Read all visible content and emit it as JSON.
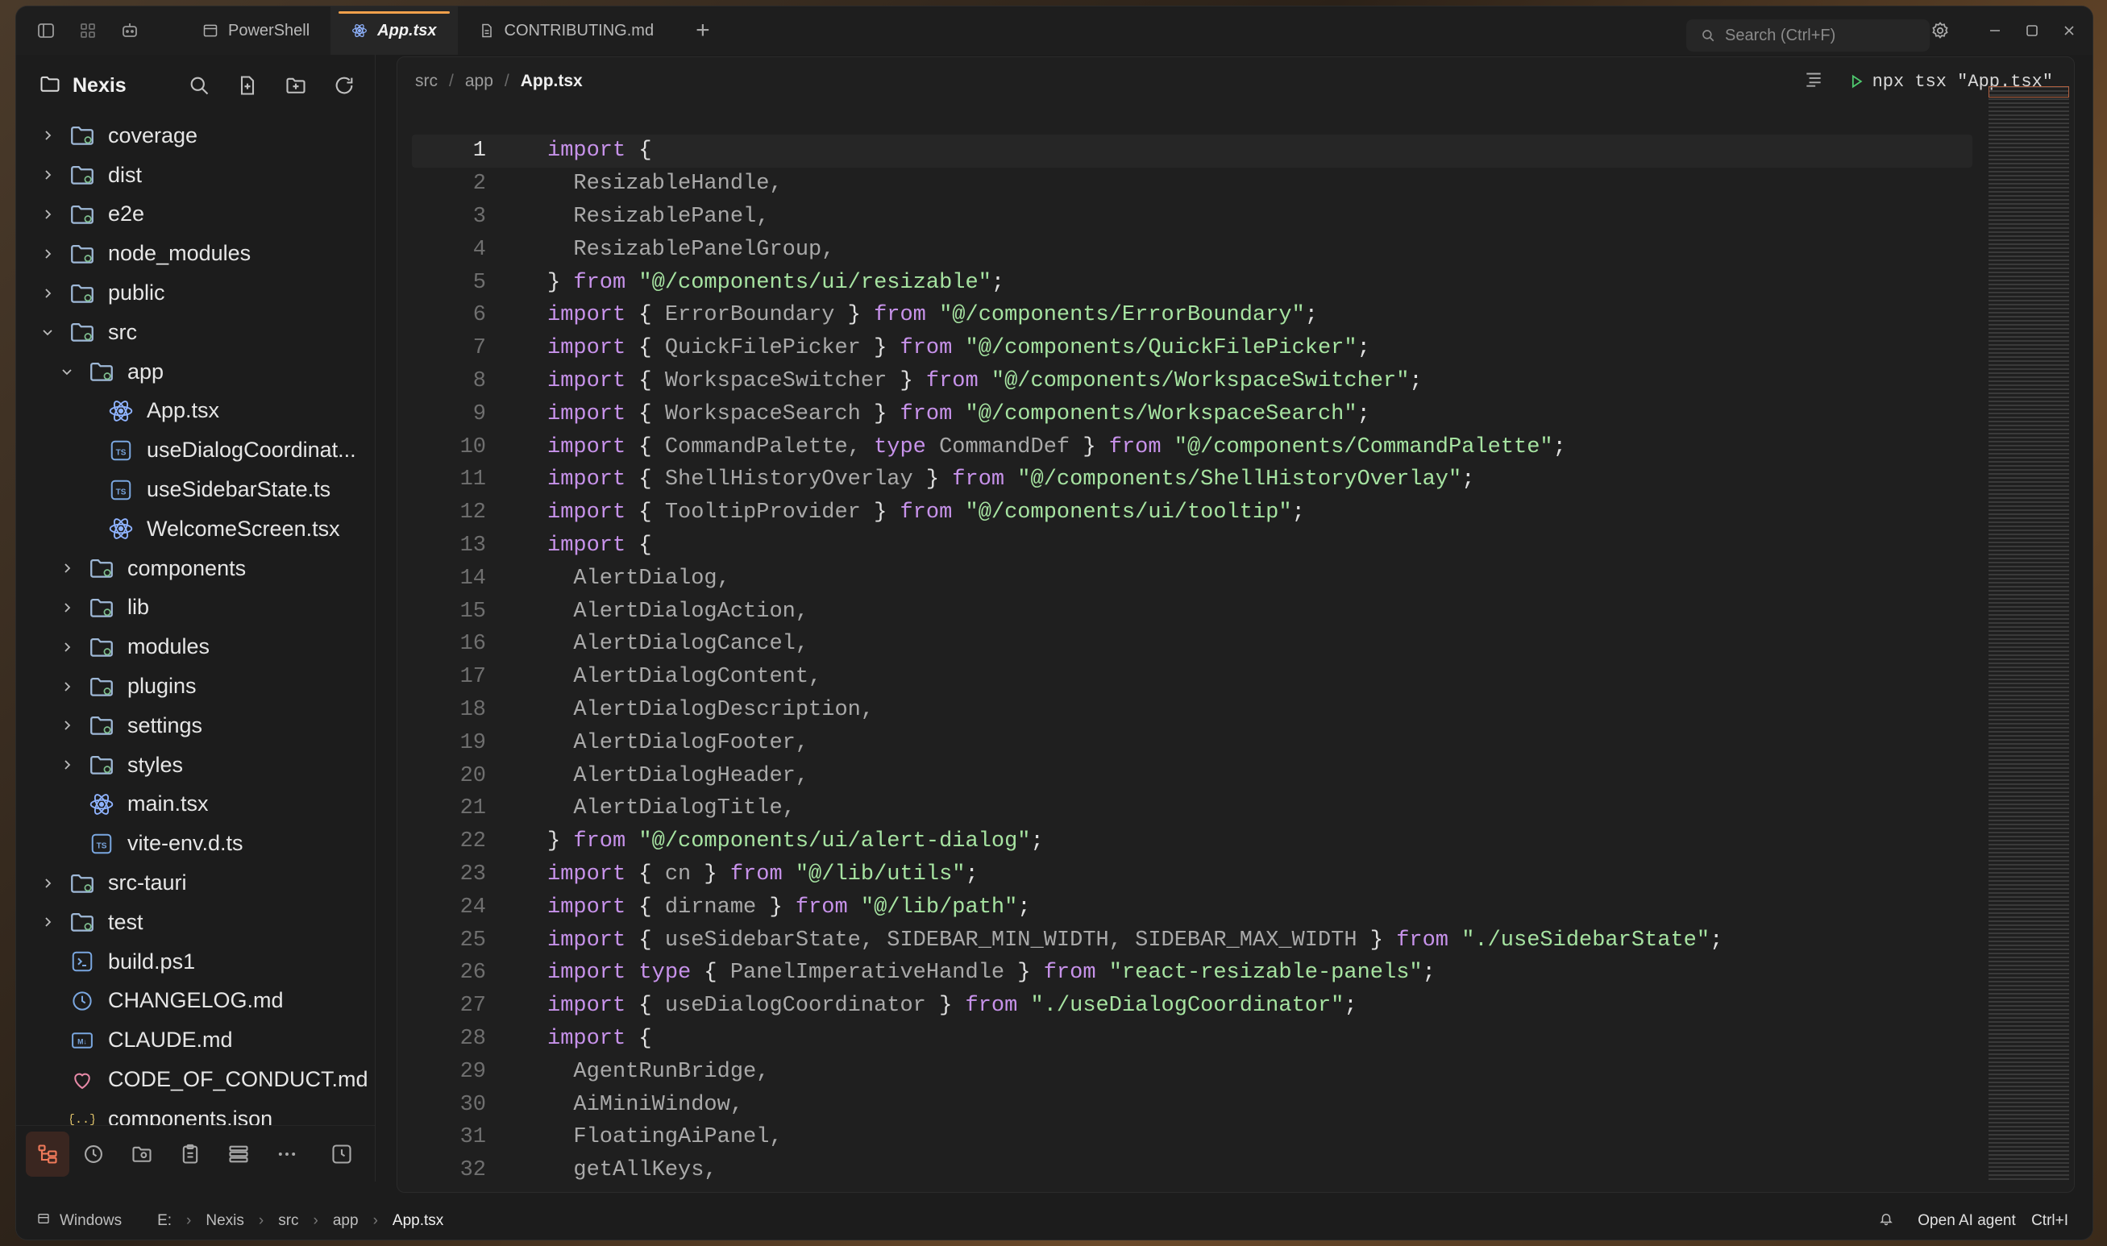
{
  "titlebar": {
    "tabs": [
      {
        "label": "PowerShell",
        "icon": "terminal-icon",
        "active": false
      },
      {
        "label": "App.tsx",
        "icon": "react-icon",
        "active": true
      },
      {
        "label": "CONTRIBUTING.md",
        "icon": "document-icon",
        "active": false
      }
    ],
    "new_tab": "+",
    "search_placeholder": "Search (Ctrl+F)"
  },
  "sidebar": {
    "title": "Nexis",
    "tree": [
      {
        "label": "coverage",
        "type": "folder",
        "expanded": false,
        "depth": 0
      },
      {
        "label": "dist",
        "type": "folder",
        "expanded": false,
        "depth": 0
      },
      {
        "label": "e2e",
        "type": "folder",
        "expanded": false,
        "depth": 0
      },
      {
        "label": "node_modules",
        "type": "folder",
        "expanded": false,
        "depth": 0
      },
      {
        "label": "public",
        "type": "folder",
        "expanded": false,
        "depth": 0
      },
      {
        "label": "src",
        "type": "folder",
        "expanded": true,
        "depth": 0
      },
      {
        "label": "app",
        "type": "folder",
        "expanded": true,
        "depth": 1
      },
      {
        "label": "App.tsx",
        "type": "react",
        "depth": 2
      },
      {
        "label": "useDialogCoordinat...",
        "type": "ts",
        "depth": 2
      },
      {
        "label": "useSidebarState.ts",
        "type": "ts",
        "depth": 2
      },
      {
        "label": "WelcomeScreen.tsx",
        "type": "react",
        "depth": 2
      },
      {
        "label": "components",
        "type": "folder",
        "expanded": false,
        "depth": 1
      },
      {
        "label": "lib",
        "type": "folder",
        "expanded": false,
        "depth": 1
      },
      {
        "label": "modules",
        "type": "folder",
        "expanded": false,
        "depth": 1
      },
      {
        "label": "plugins",
        "type": "folder",
        "expanded": false,
        "depth": 1
      },
      {
        "label": "settings",
        "type": "folder",
        "expanded": false,
        "depth": 1
      },
      {
        "label": "styles",
        "type": "folder",
        "expanded": false,
        "depth": 1
      },
      {
        "label": "main.tsx",
        "type": "react",
        "depth": 1
      },
      {
        "label": "vite-env.d.ts",
        "type": "ts",
        "depth": 1
      },
      {
        "label": "src-tauri",
        "type": "folder",
        "expanded": false,
        "depth": 0
      },
      {
        "label": "test",
        "type": "folder",
        "expanded": false,
        "depth": 0
      },
      {
        "label": "build.ps1",
        "type": "ps",
        "depth": 0
      },
      {
        "label": "CHANGELOG.md",
        "type": "history",
        "depth": 0
      },
      {
        "label": "CLAUDE.md",
        "type": "md",
        "depth": 0
      },
      {
        "label": "CODE_OF_CONDUCT.md",
        "type": "heart",
        "depth": 0
      },
      {
        "label": "components.json",
        "type": "json",
        "depth": 0
      }
    ]
  },
  "editor": {
    "breadcrumb": [
      "src",
      "app",
      "App.tsx"
    ],
    "run_label": "npx tsx \"App.tsx\"",
    "lines": [
      [
        [
          "kw",
          "import"
        ],
        [
          "punc",
          " {"
        ]
      ],
      [
        [
          "ident",
          "  ResizableHandle,"
        ]
      ],
      [
        [
          "ident",
          "  ResizablePanel,"
        ]
      ],
      [
        [
          "ident",
          "  ResizablePanelGroup,"
        ]
      ],
      [
        [
          "punc",
          "} "
        ],
        [
          "kw",
          "from"
        ],
        [
          "str",
          " \"@/components/ui/resizable\""
        ],
        [
          "punc",
          ";"
        ]
      ],
      [
        [
          "kw",
          "import"
        ],
        [
          "punc",
          " { "
        ],
        [
          "ident",
          "ErrorBoundary"
        ],
        [
          "punc",
          " } "
        ],
        [
          "kw",
          "from"
        ],
        [
          "str",
          " \"@/components/ErrorBoundary\""
        ],
        [
          "punc",
          ";"
        ]
      ],
      [
        [
          "kw",
          "import"
        ],
        [
          "punc",
          " { "
        ],
        [
          "ident",
          "QuickFilePicker"
        ],
        [
          "punc",
          " } "
        ],
        [
          "kw",
          "from"
        ],
        [
          "str",
          " \"@/components/QuickFilePicker\""
        ],
        [
          "punc",
          ";"
        ]
      ],
      [
        [
          "kw",
          "import"
        ],
        [
          "punc",
          " { "
        ],
        [
          "ident",
          "WorkspaceSwitcher"
        ],
        [
          "punc",
          " } "
        ],
        [
          "kw",
          "from"
        ],
        [
          "str",
          " \"@/components/WorkspaceSwitcher\""
        ],
        [
          "punc",
          ";"
        ]
      ],
      [
        [
          "kw",
          "import"
        ],
        [
          "punc",
          " { "
        ],
        [
          "ident",
          "WorkspaceSearch"
        ],
        [
          "punc",
          " } "
        ],
        [
          "kw",
          "from"
        ],
        [
          "str",
          " \"@/components/WorkspaceSearch\""
        ],
        [
          "punc",
          ";"
        ]
      ],
      [
        [
          "kw",
          "import"
        ],
        [
          "punc",
          " { "
        ],
        [
          "ident",
          "CommandPalette, "
        ],
        [
          "kw",
          "type"
        ],
        [
          "ident",
          " CommandDef"
        ],
        [
          "punc",
          " } "
        ],
        [
          "kw",
          "from"
        ],
        [
          "str",
          " \"@/components/CommandPalette\""
        ],
        [
          "punc",
          ";"
        ]
      ],
      [
        [
          "kw",
          "import"
        ],
        [
          "punc",
          " { "
        ],
        [
          "ident",
          "ShellHistoryOverlay"
        ],
        [
          "punc",
          " } "
        ],
        [
          "kw",
          "from"
        ],
        [
          "str",
          " \"@/components/ShellHistoryOverlay\""
        ],
        [
          "punc",
          ";"
        ]
      ],
      [
        [
          "kw",
          "import"
        ],
        [
          "punc",
          " { "
        ],
        [
          "ident",
          "TooltipProvider"
        ],
        [
          "punc",
          " } "
        ],
        [
          "kw",
          "from"
        ],
        [
          "str",
          " \"@/components/ui/tooltip\""
        ],
        [
          "punc",
          ";"
        ]
      ],
      [
        [
          "kw",
          "import"
        ],
        [
          "punc",
          " {"
        ]
      ],
      [
        [
          "ident",
          "  AlertDialog,"
        ]
      ],
      [
        [
          "ident",
          "  AlertDialogAction,"
        ]
      ],
      [
        [
          "ident",
          "  AlertDialogCancel,"
        ]
      ],
      [
        [
          "ident",
          "  AlertDialogContent,"
        ]
      ],
      [
        [
          "ident",
          "  AlertDialogDescription,"
        ]
      ],
      [
        [
          "ident",
          "  AlertDialogFooter,"
        ]
      ],
      [
        [
          "ident",
          "  AlertDialogHeader,"
        ]
      ],
      [
        [
          "ident",
          "  AlertDialogTitle,"
        ]
      ],
      [
        [
          "punc",
          "} "
        ],
        [
          "kw",
          "from"
        ],
        [
          "str",
          " \"@/components/ui/alert-dialog\""
        ],
        [
          "punc",
          ";"
        ]
      ],
      [
        [
          "kw",
          "import"
        ],
        [
          "punc",
          " { "
        ],
        [
          "ident",
          "cn"
        ],
        [
          "punc",
          " } "
        ],
        [
          "kw",
          "from"
        ],
        [
          "str",
          " \"@/lib/utils\""
        ],
        [
          "punc",
          ";"
        ]
      ],
      [
        [
          "kw",
          "import"
        ],
        [
          "punc",
          " { "
        ],
        [
          "ident",
          "dirname"
        ],
        [
          "punc",
          " } "
        ],
        [
          "kw",
          "from"
        ],
        [
          "str",
          " \"@/lib/path\""
        ],
        [
          "punc",
          ";"
        ]
      ],
      [
        [
          "kw",
          "import"
        ],
        [
          "punc",
          " { "
        ],
        [
          "ident",
          "useSidebarState, SIDEBAR_MIN_WIDTH, SIDEBAR_MAX_WIDTH"
        ],
        [
          "punc",
          " } "
        ],
        [
          "kw",
          "from"
        ],
        [
          "str",
          " \"./useSidebarState\""
        ],
        [
          "punc",
          ";"
        ]
      ],
      [
        [
          "kw",
          "import type"
        ],
        [
          "punc",
          " { "
        ],
        [
          "ident",
          "PanelImperativeHandle"
        ],
        [
          "punc",
          " } "
        ],
        [
          "kw",
          "from"
        ],
        [
          "str",
          " \"react-resizable-panels\""
        ],
        [
          "punc",
          ";"
        ]
      ],
      [
        [
          "kw",
          "import"
        ],
        [
          "punc",
          " { "
        ],
        [
          "ident",
          "useDialogCoordinator"
        ],
        [
          "punc",
          " } "
        ],
        [
          "kw",
          "from"
        ],
        [
          "str",
          " \"./useDialogCoordinator\""
        ],
        [
          "punc",
          ";"
        ]
      ],
      [
        [
          "kw",
          "import"
        ],
        [
          "punc",
          " {"
        ]
      ],
      [
        [
          "ident",
          "  AgentRunBridge,"
        ]
      ],
      [
        [
          "ident",
          "  AiMiniWindow,"
        ]
      ],
      [
        [
          "ident",
          "  FloatingAiPanel,"
        ]
      ],
      [
        [
          "ident",
          "  getAllKeys,"
        ]
      ]
    ]
  },
  "statusbar": {
    "items": [
      "Windows",
      "E:",
      "Nexis",
      "src",
      "app",
      "App.tsx"
    ],
    "ai_label": "Open AI agent",
    "ai_shortcut": "Ctrl+I"
  },
  "colors": {
    "accent": "#f0a04b",
    "keyword": "#c792ea",
    "string": "#a6e3a1",
    "folder_icon": "#8fb3d9"
  }
}
